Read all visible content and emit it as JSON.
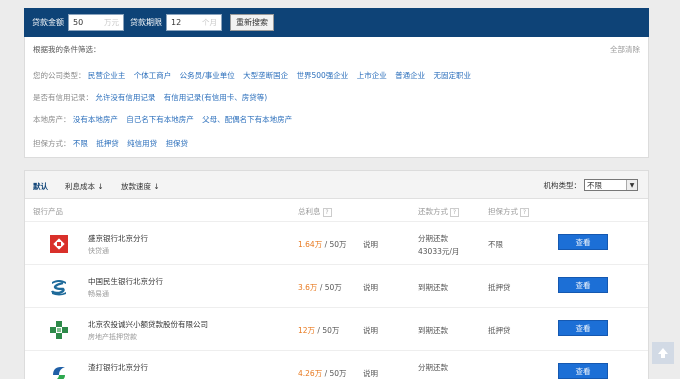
{
  "search": {
    "amount_label": "贷款金额",
    "amount_value": "50",
    "amount_unit": "万元",
    "term_label": "贷款期限",
    "term_value": "12",
    "term_unit": "个月",
    "button": "重新搜索"
  },
  "filters": {
    "heading": "根据我的条件筛选：",
    "clear_all": "全部清除",
    "groups": [
      {
        "label": "您的公司类型：",
        "options": [
          "民营企业主",
          "个体工商户",
          "公务员/事业单位",
          "大型垄断国企",
          "世界500强企业",
          "上市企业",
          "普通企业",
          "无固定职业"
        ]
      },
      {
        "label": "是否有信用记录：",
        "options": [
          "允许没有信用记录",
          "有信用记录(有信用卡、房贷等)"
        ]
      },
      {
        "label": "本地房产：",
        "options": [
          "没有本地房产",
          "自己名下有本地房产",
          "父母、配偶名下有本地房产"
        ]
      },
      {
        "label": "担保方式：",
        "options": [
          "不限",
          "抵押贷",
          "纯信用贷",
          "担保贷"
        ]
      }
    ]
  },
  "sortbar": {
    "default": "默认",
    "interest": "利息成本",
    "speed": "放款速度",
    "inst_label": "机构类型：",
    "inst_value": "不限"
  },
  "columns": {
    "product": "银行产品",
    "total_interest": "总利息",
    "repay": "还款方式",
    "guarantee": "担保方式"
  },
  "rows": [
    {
      "bank": "盛京银行北京分行",
      "product": "快贷通",
      "rate": "1.64万",
      "total": " / 50万",
      "explain": "说明",
      "repay": "分期还款",
      "monthly": "43033元/月",
      "guarantee": "不限",
      "action": "查看",
      "color": "#d9302a"
    },
    {
      "bank": "中国民生银行北京分行",
      "product": "畅易通",
      "rate": "3.6万",
      "total": " / 50万",
      "explain": "说明",
      "repay": "到期还款",
      "monthly": "",
      "guarantee": "抵押贷",
      "action": "查看",
      "color": "#1e6a9a"
    },
    {
      "bank": "北京农投诚兴小额贷款股份有限公司",
      "product": "房地产抵押贷款",
      "rate": "12万",
      "total": " / 50万",
      "explain": "说明",
      "repay": "到期还款",
      "monthly": "",
      "guarantee": "抵押贷",
      "action": "查看",
      "color": "#2e8a4a"
    },
    {
      "bank": "渣打银行北京分行",
      "product": "",
      "rate": "4.26万",
      "total": " / 50万",
      "explain": "说明",
      "repay": "分期还款",
      "monthly": "",
      "guarantee": "",
      "action": "查看",
      "color": "#1f5fa6"
    }
  ]
}
